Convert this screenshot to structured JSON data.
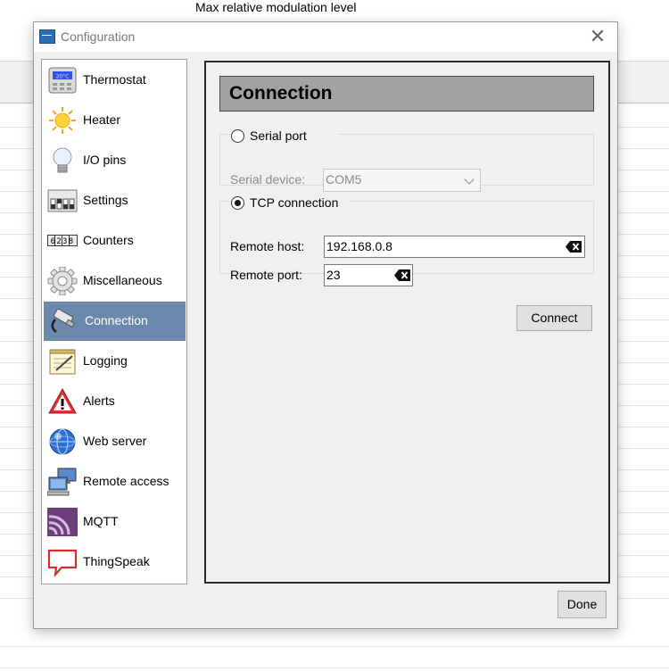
{
  "background": {
    "title": "Max relative modulation level"
  },
  "dialog": {
    "title": "Configuration",
    "close_glyph": "✕"
  },
  "sidebar": {
    "items": [
      {
        "label": "Thermostat",
        "icon": "thermostat-icon"
      },
      {
        "label": "Heater",
        "icon": "sun-icon"
      },
      {
        "label": "I/O pins",
        "icon": "lightbulb-icon"
      },
      {
        "label": "Settings",
        "icon": "switches-icon"
      },
      {
        "label": "Counters",
        "icon": "counter-icon"
      },
      {
        "label": "Miscellaneous",
        "icon": "gear-icon"
      },
      {
        "label": "Connection",
        "icon": "cable-icon",
        "selected": true
      },
      {
        "label": "Logging",
        "icon": "notepad-icon"
      },
      {
        "label": "Alerts",
        "icon": "warning-icon"
      },
      {
        "label": "Web server",
        "icon": "globe-icon"
      },
      {
        "label": "Remote access",
        "icon": "computers-icon"
      },
      {
        "label": "MQTT",
        "icon": "broadcast-icon"
      },
      {
        "label": "ThingSpeak",
        "icon": "speech-bubble-icon"
      }
    ],
    "counter_digits": "6238",
    "thermostat_readout": "20°C"
  },
  "panel": {
    "heading": "Connection",
    "serial": {
      "label": "Serial port",
      "selected": false,
      "device_label": "Serial device:",
      "device_value": "COM5"
    },
    "tcp": {
      "label": "TCP connection",
      "selected": true,
      "host_label": "Remote host:",
      "host_value": "192.168.0.8",
      "port_label": "Remote port:",
      "port_value": "23"
    },
    "connect_label": "Connect"
  },
  "footer": {
    "done_label": "Done"
  }
}
